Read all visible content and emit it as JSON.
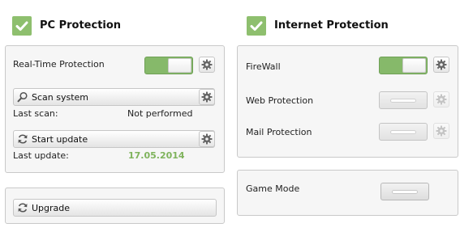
{
  "pc_protection": {
    "title": "PC Protection",
    "realtime": {
      "label": "Real-Time Protection",
      "state": "on"
    },
    "scan": {
      "button_label": "Scan system",
      "last_label": "Last scan:",
      "last_value": "Not performed"
    },
    "update": {
      "button_label": "Start update",
      "last_label": "Last update:",
      "last_value": "17.05.2014"
    },
    "upgrade": {
      "button_label": "Upgrade"
    }
  },
  "internet_protection": {
    "title": "Internet Protection",
    "firewall": {
      "label": "FireWall",
      "state": "on"
    },
    "web": {
      "label": "Web Protection",
      "state": "off"
    },
    "mail": {
      "label": "Mail Protection",
      "state": "off"
    }
  },
  "game_mode": {
    "label": "Game Mode",
    "state": "off"
  },
  "colors": {
    "accent_green": "#8ebf6e",
    "date_green": "#7fb35c"
  },
  "icons": {
    "section_check": "check-icon",
    "settings": "gear-icon",
    "search": "magnifier-icon",
    "refresh": "refresh-icon"
  }
}
